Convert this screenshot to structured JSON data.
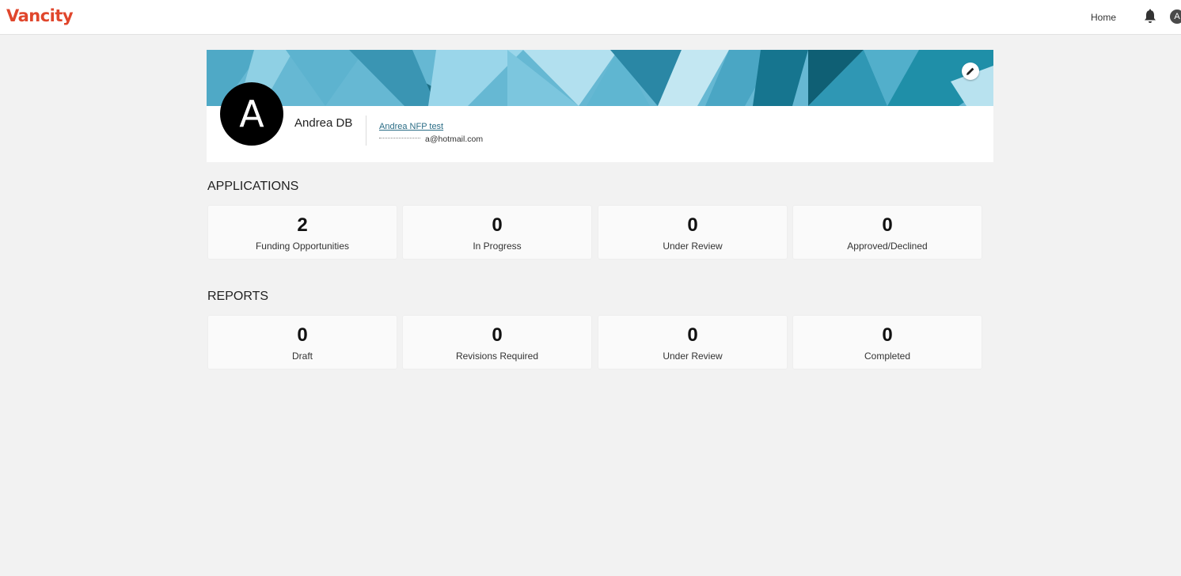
{
  "brand": {
    "name": "Vancity",
    "color": "#e0462c"
  },
  "nav": {
    "home_label": "Home",
    "avatar_initial": "A"
  },
  "profile": {
    "avatar_initial": "A",
    "name": "Andrea DB",
    "org_link": "Andrea NFP test",
    "email": "a@hotmail.com"
  },
  "applications": {
    "title": "APPLICATIONS",
    "stats": [
      {
        "value": "2",
        "label": "Funding Opportunities"
      },
      {
        "value": "0",
        "label": "In Progress"
      },
      {
        "value": "0",
        "label": "Under Review"
      },
      {
        "value": "0",
        "label": "Approved/Declined"
      }
    ]
  },
  "reports": {
    "title": "REPORTS",
    "stats": [
      {
        "value": "0",
        "label": "Draft"
      },
      {
        "value": "0",
        "label": "Revisions Required"
      },
      {
        "value": "0",
        "label": "Under Review"
      },
      {
        "value": "0",
        "label": "Completed"
      }
    ]
  },
  "colors": {
    "banner_teal": "#1f8fa8",
    "banner_light": "#7cc6de",
    "background": "#f2f2f2",
    "link": "#2b6d86"
  }
}
